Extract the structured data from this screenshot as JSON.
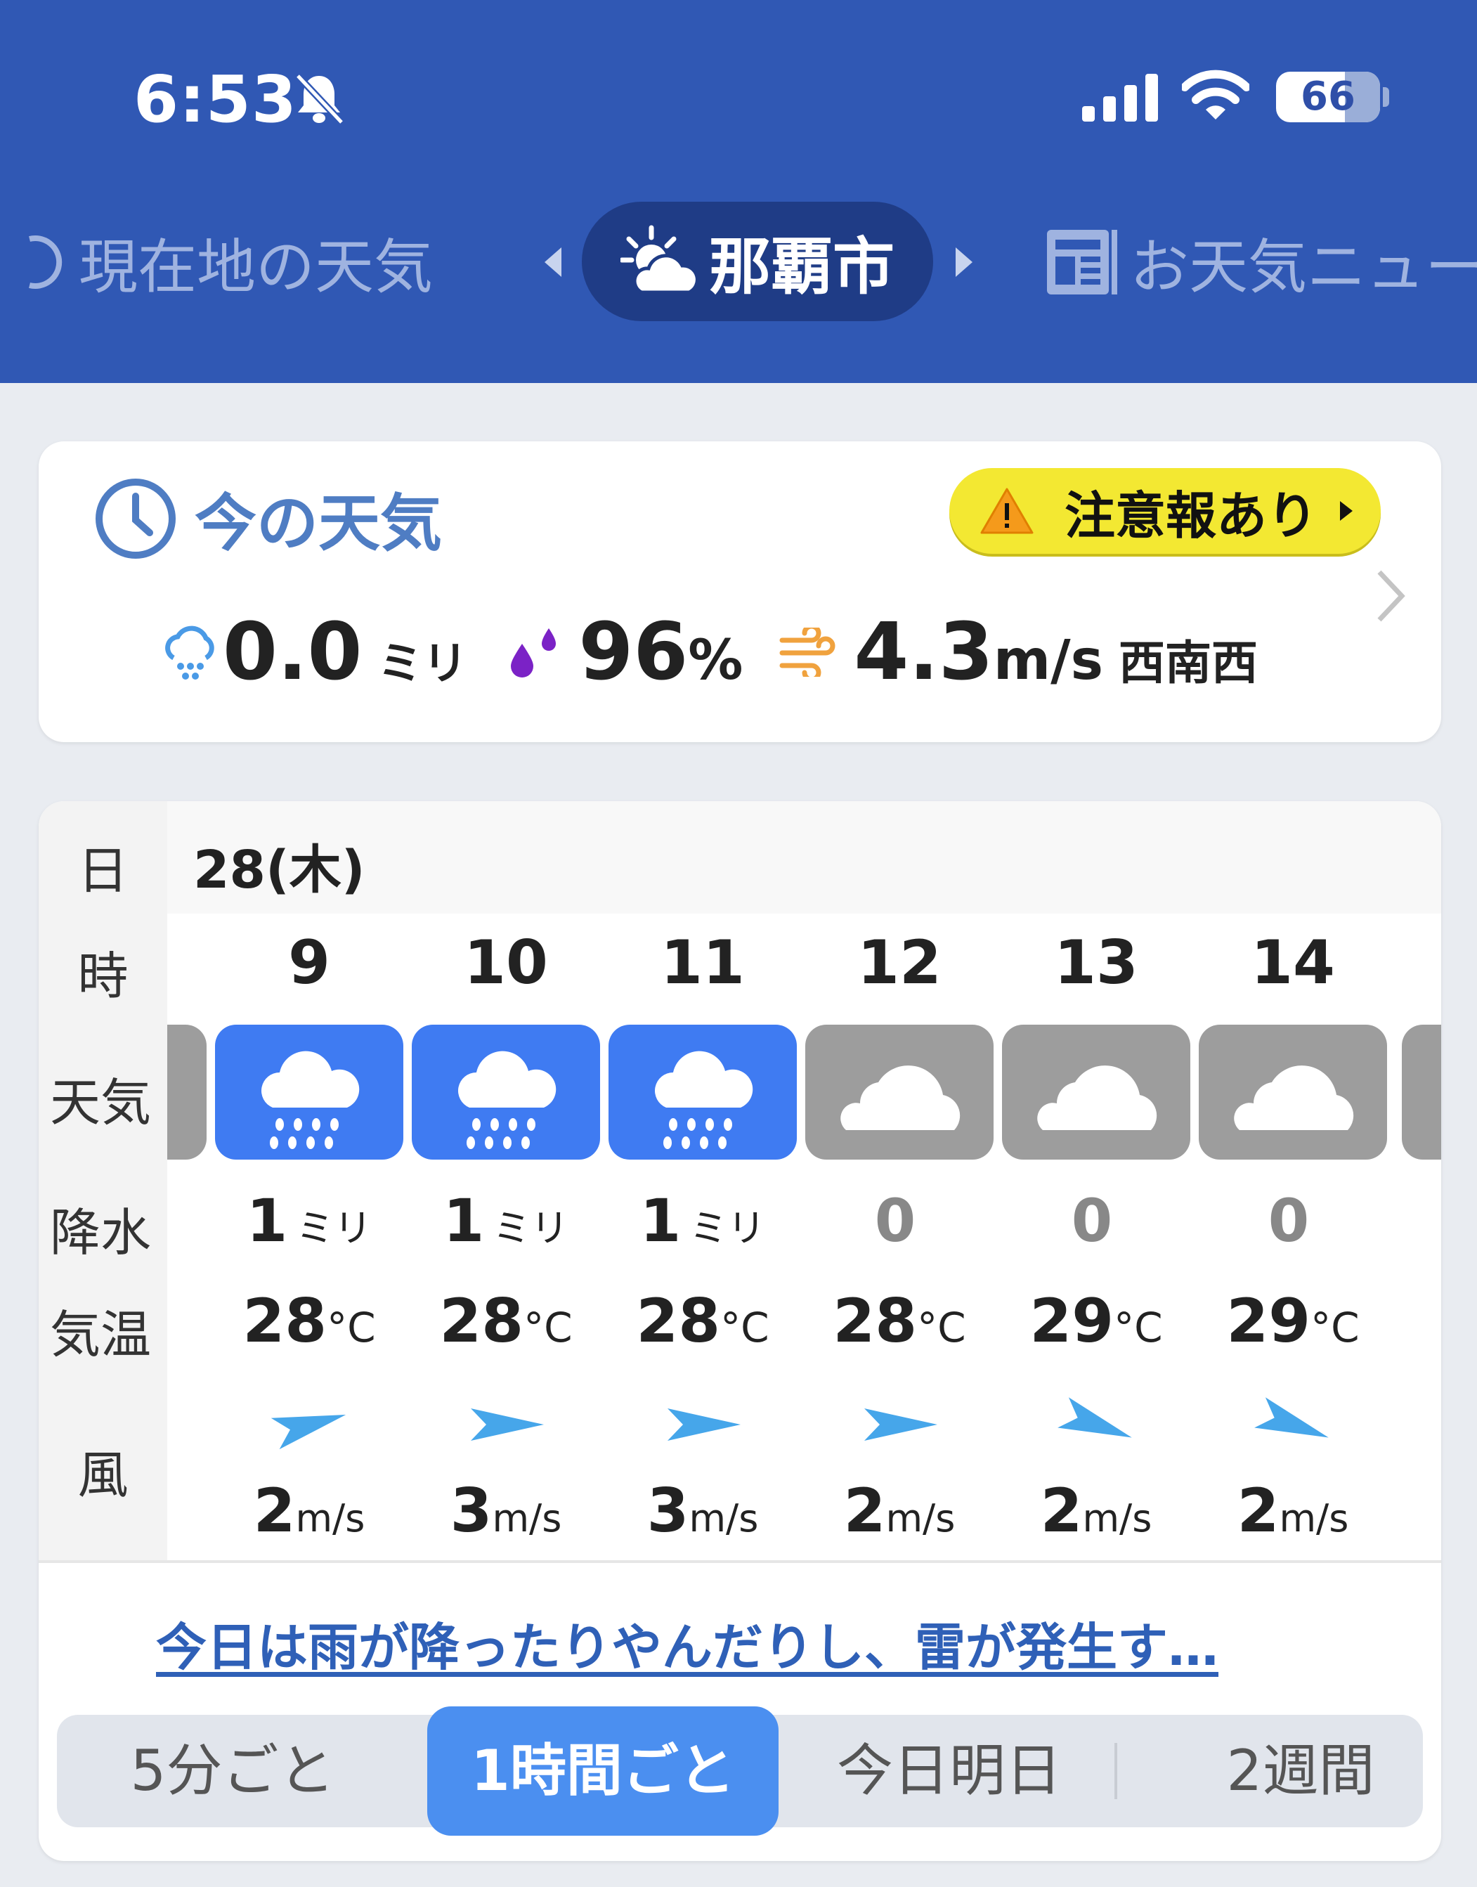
{
  "status_bar": {
    "time": "6:53",
    "battery": "66",
    "battery_level": 0.66
  },
  "nav": {
    "left_label": "現在地の天気",
    "city": "那覇市",
    "right_label": "お天気ニュー"
  },
  "now": {
    "title": "今の天気",
    "alert": "注意報あり",
    "rain_value": "0.0",
    "rain_unit": "ミリ",
    "humidity_value": "96",
    "humidity_unit": "%",
    "wind_value": "4.3",
    "wind_unit": "m/s",
    "wind_dir": "西南西"
  },
  "forecast": {
    "row_labels": {
      "day": "日",
      "hour": "時",
      "weather": "天気",
      "precip": "降水",
      "temp": "気温",
      "wind": "風"
    },
    "date": "28(木)",
    "hours": [
      {
        "hour": "9",
        "weather": "rain",
        "precip": "1",
        "precip_unit": "ミリ",
        "temp": "28",
        "temp_unit": "°C",
        "wind": "2",
        "wind_unit": "m/s",
        "wind_dir_deg": -15
      },
      {
        "hour": "10",
        "weather": "rain",
        "precip": "1",
        "precip_unit": "ミリ",
        "temp": "28",
        "temp_unit": "°C",
        "wind": "3",
        "wind_unit": "m/s",
        "wind_dir_deg": 0
      },
      {
        "hour": "11",
        "weather": "rain",
        "precip": "1",
        "precip_unit": "ミリ",
        "temp": "28",
        "temp_unit": "°C",
        "wind": "3",
        "wind_unit": "m/s",
        "wind_dir_deg": 0
      },
      {
        "hour": "12",
        "weather": "cloudy",
        "precip": "0",
        "precip_unit": "",
        "temp": "28",
        "temp_unit": "°C",
        "wind": "2",
        "wind_unit": "m/s",
        "wind_dir_deg": 0
      },
      {
        "hour": "13",
        "weather": "cloudy",
        "precip": "0",
        "precip_unit": "",
        "temp": "29",
        "temp_unit": "°C",
        "wind": "2",
        "wind_unit": "m/s",
        "wind_dir_deg": 20
      },
      {
        "hour": "14",
        "weather": "cloudy",
        "precip": "0",
        "precip_unit": "",
        "temp": "29",
        "temp_unit": "°C",
        "wind": "2",
        "wind_unit": "m/s",
        "wind_dir_deg": 20
      }
    ],
    "summary": "今日は雨が降ったりやんだりし、雷が発生す…"
  },
  "tabs": [
    {
      "label": "5分ごと",
      "active": false
    },
    {
      "label": "1時間ごと",
      "active": true
    },
    {
      "label": "今日明日",
      "active": false
    },
    {
      "label": "2週間",
      "active": false
    }
  ],
  "colors": {
    "header": "#3058b4",
    "pill": "#1f3c86",
    "rain_box": "#3f7bf2",
    "cloud_box": "#9d9d9d",
    "wind_arrow": "#46a6ea",
    "alert": "#f3e832"
  },
  "icons": [
    "bell-slash-icon",
    "signal-icon",
    "wifi-icon",
    "battery-icon",
    "location-icon",
    "sun-cloud-icon",
    "news-icon",
    "clock-icon",
    "warning-icon",
    "rain-gauge-icon",
    "humidity-drop-icon",
    "wind-icon",
    "rain-cloud-icon",
    "cloud-icon",
    "wind-arrow-icon",
    "chevron-right-icon"
  ]
}
